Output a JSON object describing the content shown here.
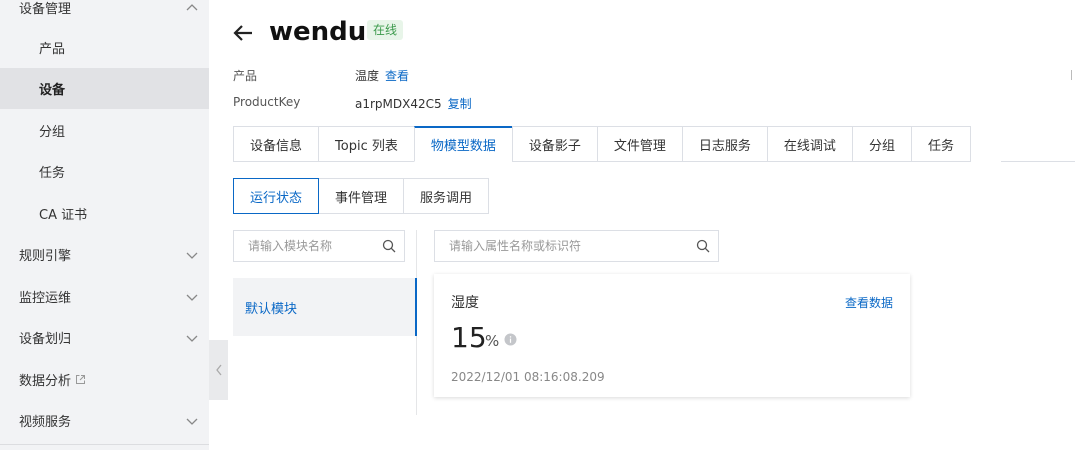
{
  "sidebar": {
    "items": [
      {
        "label": "设备管理"
      },
      {
        "label": "产品"
      },
      {
        "label": "设备"
      },
      {
        "label": "分组"
      },
      {
        "label": "任务"
      },
      {
        "label": "CA 证书"
      },
      {
        "label": "规则引擎"
      },
      {
        "label": "监控运维"
      },
      {
        "label": "设备划归"
      },
      {
        "label": "数据分析"
      },
      {
        "label": "视频服务"
      }
    ],
    "active_index": 2
  },
  "header": {
    "title": "wendu",
    "status": "在线",
    "product_label": "产品",
    "product_value": "温度",
    "product_link": "查看",
    "productkey_label": "ProductKey",
    "productkey_value": "a1rpMDX42C5",
    "productkey_link": "复制"
  },
  "tabs": [
    {
      "label": "设备信息"
    },
    {
      "label": "Topic 列表"
    },
    {
      "label": "物模型数据"
    },
    {
      "label": "设备影子"
    },
    {
      "label": "文件管理"
    },
    {
      "label": "日志服务"
    },
    {
      "label": "在线调试"
    },
    {
      "label": "分组"
    },
    {
      "label": "任务"
    }
  ],
  "active_tab": 2,
  "subtabs": [
    {
      "label": "运行状态"
    },
    {
      "label": "事件管理"
    },
    {
      "label": "服务调用"
    }
  ],
  "active_subtab": 0,
  "module_search": {
    "placeholder": "请输入模块名称"
  },
  "property_search": {
    "placeholder": "请输入属性名称或标识符"
  },
  "modules": [
    {
      "label": "默认模块"
    }
  ],
  "property_card": {
    "name": "湿度",
    "link": "查看数据",
    "value": "15",
    "unit": "%",
    "timestamp": "2022/12/01 08:16:08.209"
  },
  "colors": {
    "accent": "#0a68c6",
    "online_bg": "#e8f5e9",
    "online_text": "#3c9a4c",
    "sidebar_bg": "#f2f3f5"
  }
}
